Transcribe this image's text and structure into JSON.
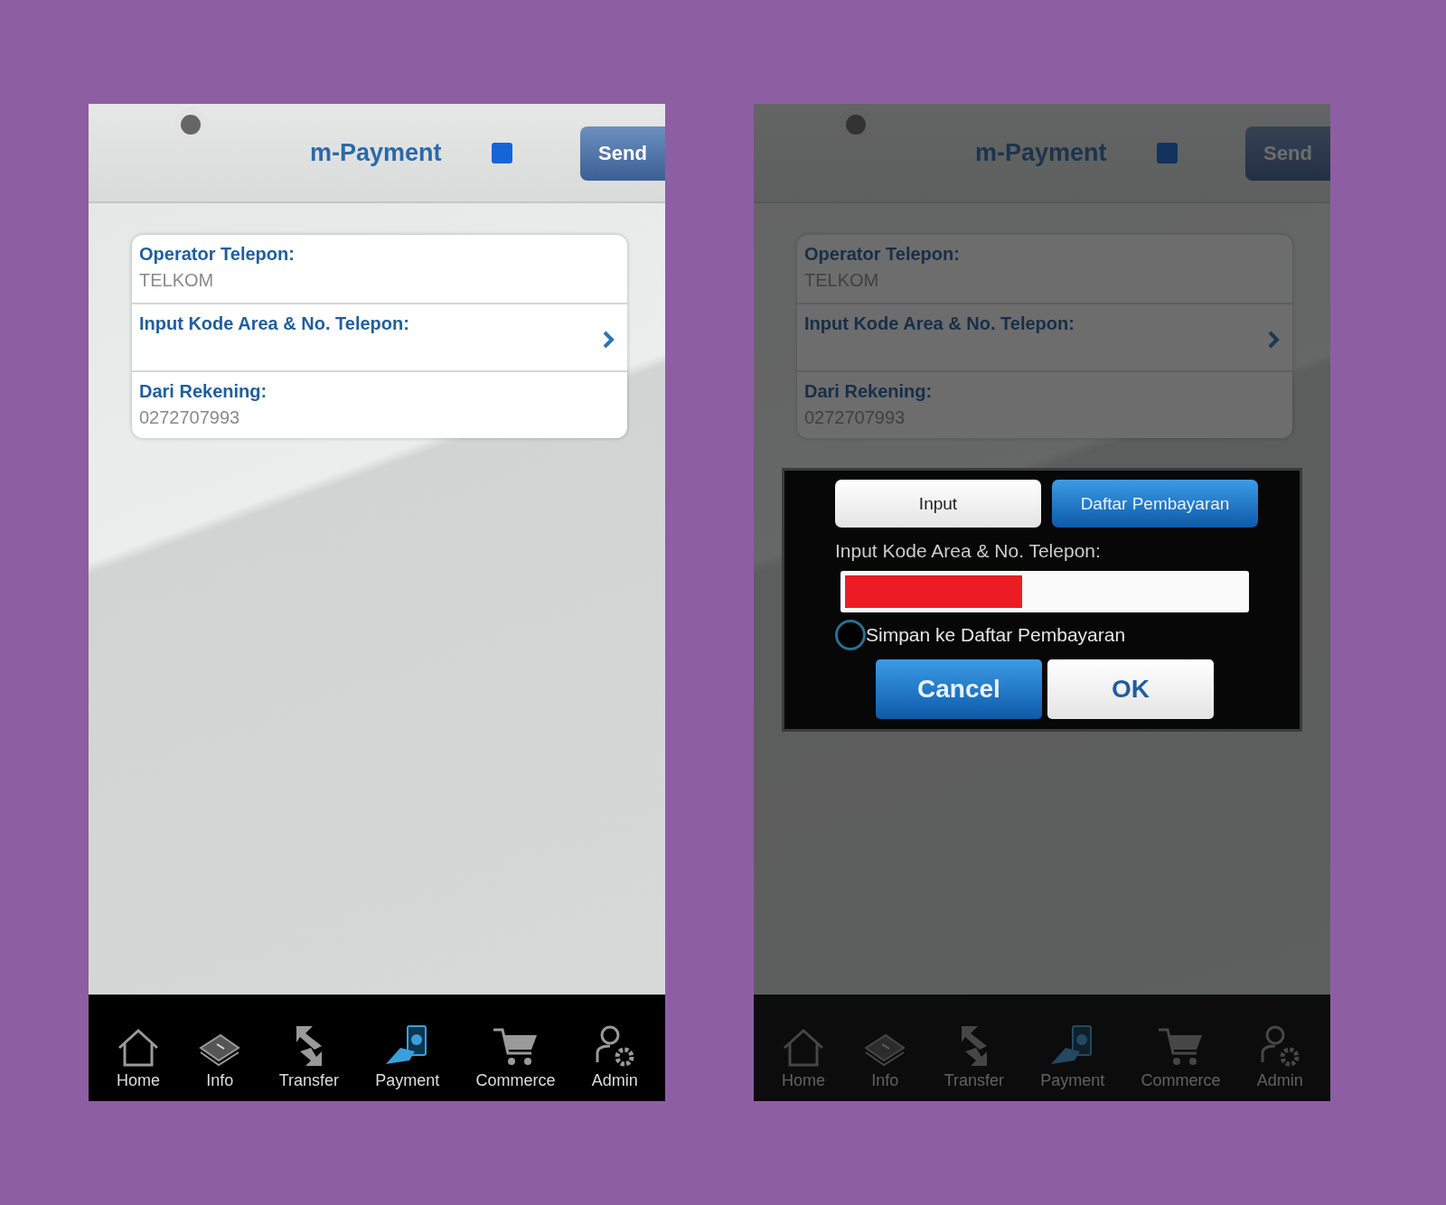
{
  "screens": [
    {
      "header": {
        "title": "m-Payment",
        "send_button": "Send"
      },
      "form": [
        {
          "kind": "info",
          "label": "Operator Telepon:",
          "value": "TELKOM"
        },
        {
          "kind": "link",
          "label": "Input Kode Area & No. Telepon:"
        },
        {
          "kind": "info",
          "label": "Dari Rekening:",
          "value": "0272707993"
        }
      ],
      "nav": [
        {
          "label": "Home",
          "selected": false
        },
        {
          "label": "Info",
          "selected": false
        },
        {
          "label": "Transfer",
          "selected": false
        },
        {
          "label": "Payment",
          "selected": true
        },
        {
          "label": "Commerce",
          "selected": false
        },
        {
          "label": "Admin",
          "selected": false
        }
      ]
    },
    {
      "header": {
        "title": "m-Payment",
        "send_button": "Send"
      },
      "form": [
        {
          "kind": "info",
          "label": "Operator Telepon:",
          "value": "TELKOM"
        },
        {
          "kind": "link",
          "label": "Input Kode Area & No. Telepon:"
        },
        {
          "kind": "info",
          "label": "Dari Rekening:",
          "value": "0272707993"
        }
      ],
      "nav": [
        {
          "label": "Home",
          "selected": false
        },
        {
          "label": "Info",
          "selected": false
        },
        {
          "label": "Transfer",
          "selected": false
        },
        {
          "label": "Payment",
          "selected": true
        },
        {
          "label": "Commerce",
          "selected": false
        },
        {
          "label": "Admin",
          "selected": false
        }
      ],
      "dialog": {
        "mode_buttons": [
          {
            "label": "Input",
            "kind": "light"
          },
          {
            "label": "Daftar Pembayaran",
            "kind": "primary"
          }
        ],
        "field_label": "Input Kode Area & No. Telepon:",
        "save_option": {
          "label": "Simpan ke Daftar Pembayaran",
          "checked": false
        },
        "actions": [
          {
            "label": "Cancel",
            "kind": "primary"
          },
          {
            "label": "OK",
            "kind": "light"
          }
        ]
      }
    }
  ]
}
